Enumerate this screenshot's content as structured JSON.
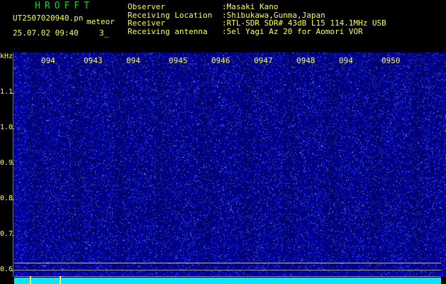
{
  "header": {
    "app_title": "HROFFT",
    "file_name": "UT2507020940.pn",
    "mode": "meteor",
    "datetime": "25.07.02 09:40",
    "counter": "3_"
  },
  "info": {
    "labels": [
      "Observer",
      "Receiving Location",
      "Receiver",
      "Receiving antenna"
    ],
    "values": [
      ":Masaki Kano",
      ":Shibukawa,Gunma,Japan",
      ":RTL-SDR SDR# 43dB L15 114.1MHz USB",
      ":5el Yagi Az 20 for Aomori VOR"
    ]
  },
  "axis": {
    "unit": "kHz",
    "time_ticks": [
      "094",
      "0943",
      "094",
      "0945",
      "0946",
      "0947",
      "0948",
      "094",
      "0950"
    ],
    "freq_ticks": [
      "1.1",
      "1.0",
      "0.9",
      "0.8",
      "0.7",
      "0.6"
    ]
  },
  "colors": {
    "text": "#ffff46",
    "title": "#19c93a",
    "background": "#000000",
    "noise_low": "#00006a",
    "noise_high": "#3c46ff",
    "baseline": "#00e8ff"
  }
}
